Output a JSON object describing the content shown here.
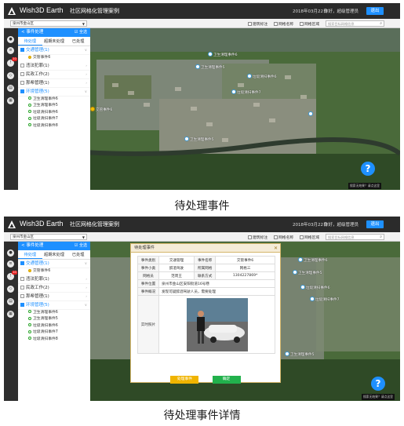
{
  "captions": {
    "pending": "待处理事件",
    "detail": "待处理事件详情"
  },
  "header": {
    "brand": "Wish3D Earth",
    "system_name": "社区网格化管理案例",
    "date": "2018年03月22日",
    "greeting": "你好，超级管理员",
    "exit_label": "退出"
  },
  "toolbar": {
    "region_value": "泉州市金山区",
    "checks": [
      "建筑标注",
      "网格名称",
      "网格区域"
    ],
    "search_placeholder": "搜索目标网格信息"
  },
  "rail": {
    "icons": [
      "user-icon",
      "list-icon",
      "alert-icon",
      "layers-icon",
      "building-icon",
      "grid-icon"
    ],
    "badge": "10"
  },
  "sidebar": {
    "title": "事件处理",
    "select_all": "全选",
    "tabs": [
      "待处理",
      "超期未处理",
      "已处理"
    ],
    "categories": [
      {
        "label": "交通管理(1)",
        "blue": true,
        "items": [
          {
            "label": "交管事件6",
            "yellow": true
          }
        ]
      },
      {
        "label": "违法犯罪(1)",
        "blue": false,
        "items": []
      },
      {
        "label": "民政工作(2)",
        "blue": false,
        "items": []
      },
      {
        "label": "那希管理(1)",
        "blue": false,
        "items": []
      },
      {
        "label": "环境管理(5)",
        "blue": true,
        "items": [
          {
            "label": "卫生清理事件6",
            "yellow": false
          },
          {
            "label": "卫生清理事件5",
            "yellow": false
          },
          {
            "label": "垃圾清扫事件6",
            "yellow": false
          },
          {
            "label": "垃圾清扫事件7",
            "yellow": false
          },
          {
            "label": "垃圾清扫事件8",
            "yellow": false
          }
        ]
      }
    ]
  },
  "map_pins": [
    "卫生清理事件6",
    "卫生清理事件5",
    "垃圾清扫事件6",
    "垃圾清扫事件7",
    "垃圾清扫事件8",
    "交管事件6",
    "卫生清理事件5"
  ],
  "map_note": "搜索无结果？请点这里",
  "detail": {
    "title": "待处理事件",
    "rows": [
      [
        "事件类别",
        "交通管理",
        "事件名称",
        "交管事件6"
      ],
      [
        "事件小类",
        "醉酒驾驶",
        "所属网格",
        "网格三"
      ],
      [
        "网格员",
        "范周王",
        "联系方式",
        "1304227869*"
      ]
    ],
    "location_label": "事件位置",
    "location_value": "泉州市金山区安阳街道16号巷",
    "desc_label": "事件概况",
    "desc_value": "发现可疑醉酒驾驶人员，需要处理",
    "photo_label": "实时照片",
    "process_button": "处理事件",
    "confirm_button": "确定"
  },
  "colors": {
    "accent": "#1e90ff",
    "topbar": "#2b2b2b",
    "modal_border": "#d4b66a"
  }
}
